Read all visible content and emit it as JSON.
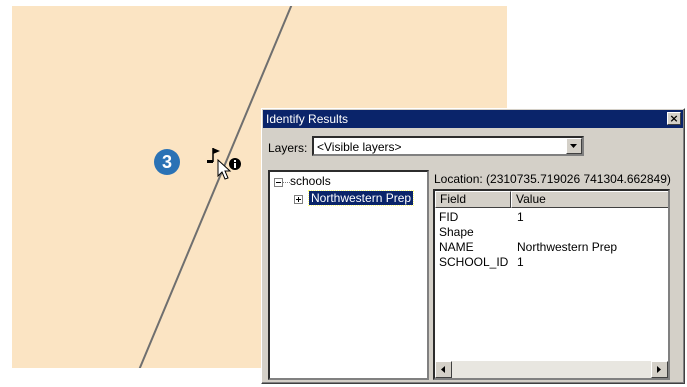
{
  "step_badge": "3",
  "dialog": {
    "title": "Identify Results",
    "close_glyph": "×",
    "layers_label": "Layers:",
    "layers_value": "<Visible layers>",
    "location": "Location: (2310735.719026  741304.662849)",
    "tree": {
      "layer": "schools",
      "feature": "Northwestern Prep"
    },
    "table": {
      "headers": {
        "field": "Field",
        "value": "Value"
      },
      "rows": [
        {
          "field": "FID",
          "value": "1"
        },
        {
          "field": "Shape",
          "value": ""
        },
        {
          "field": "NAME",
          "value": "Northwestern Prep"
        },
        {
          "field": "SCHOOL_ID",
          "value": "1"
        }
      ]
    }
  },
  "colors": {
    "map_background": "#fbe4c3",
    "road": "#6f6f6f",
    "title_bar": "#0a246a",
    "badge": "#2a72b5",
    "dialog_face": "#d4d0c8"
  },
  "icons": [
    "identify-cursor-icon",
    "flag-marker-icon",
    "info-icon",
    "chevron-down-icon",
    "expand-icon",
    "arrow-left-icon",
    "arrow-right-icon"
  ]
}
